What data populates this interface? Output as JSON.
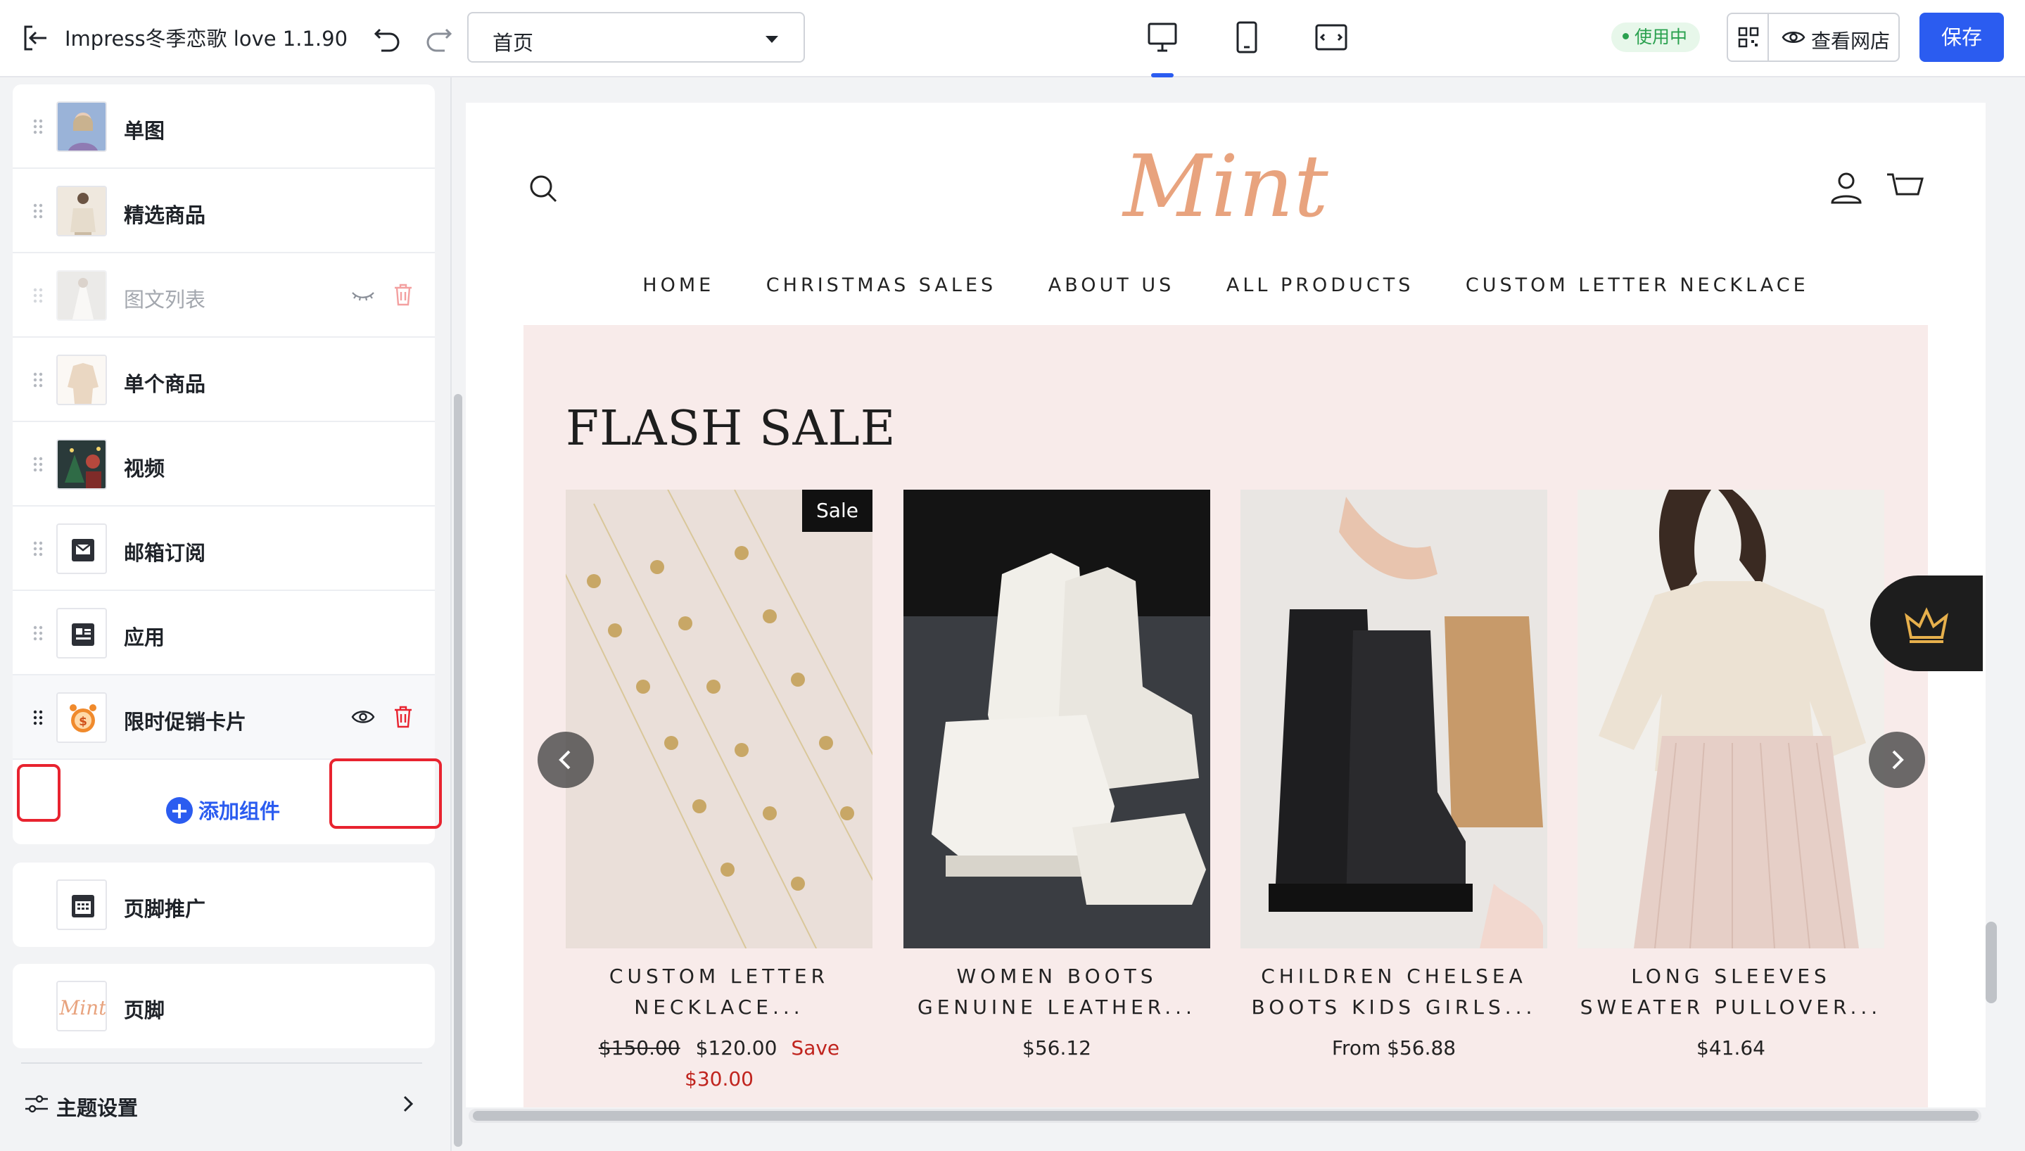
{
  "header": {
    "app_title": "Impress冬季恋歌 love 1.1.90",
    "page_selector_value": "首页",
    "status": "使用中",
    "view_store_label": "查看网店",
    "save_label": "保存",
    "active_device": "desktop"
  },
  "sidebar": {
    "items": [
      {
        "label": "单图",
        "thumb": "photo-woman"
      },
      {
        "label": "精选商品",
        "thumb": "photo-outfit"
      },
      {
        "label": "图文列表",
        "thumb": "photo-bride",
        "hidden": true
      },
      {
        "label": "单个商品",
        "thumb": "photo-sweater"
      },
      {
        "label": "视频",
        "thumb": "photo-christmas"
      },
      {
        "label": "邮箱订阅",
        "thumb": "mail-icon"
      },
      {
        "label": "应用",
        "thumb": "app-icon"
      },
      {
        "label": "限时促销卡片",
        "thumb": "alarm-icon",
        "selected": true
      }
    ],
    "add_component_label": "添加组件",
    "footer_promo_label": "页脚推广",
    "footer_label": "页脚",
    "theme_settings_label": "主题设置"
  },
  "preview": {
    "logo_text": "Mint",
    "nav": [
      "HOME",
      "CHRISTMAS SALES",
      "ABOUT US",
      "ALL PRODUCTS",
      "CUSTOM LETTER NECKLACE"
    ],
    "section_title": "FLASH SALE",
    "sale_badge": "Sale",
    "products": [
      {
        "name_line1": "CUSTOM LETTER",
        "name_line2": "NECKLACE...",
        "old_price": "$150.00",
        "price": "$120.00",
        "save_label": "Save",
        "save_amount": "$30.00"
      },
      {
        "name_line1": "WOMEN BOOTS",
        "name_line2": "GENUINE LEATHER...",
        "price": "$56.12"
      },
      {
        "name_line1": "CHILDREN CHELSEA",
        "name_line2": "BOOTS KIDS GIRLS...",
        "price": "From $56.88"
      },
      {
        "name_line1": "LONG SLEEVES",
        "name_line2": "SWEATER PULLOVER...",
        "price": "$41.64"
      }
    ]
  },
  "colors": {
    "accent": "#2b5cf0",
    "highlight": "#e8232f",
    "sale_bg": "#f8ebea",
    "status_green": "#2aa14f",
    "logo": "#e8a37e"
  }
}
